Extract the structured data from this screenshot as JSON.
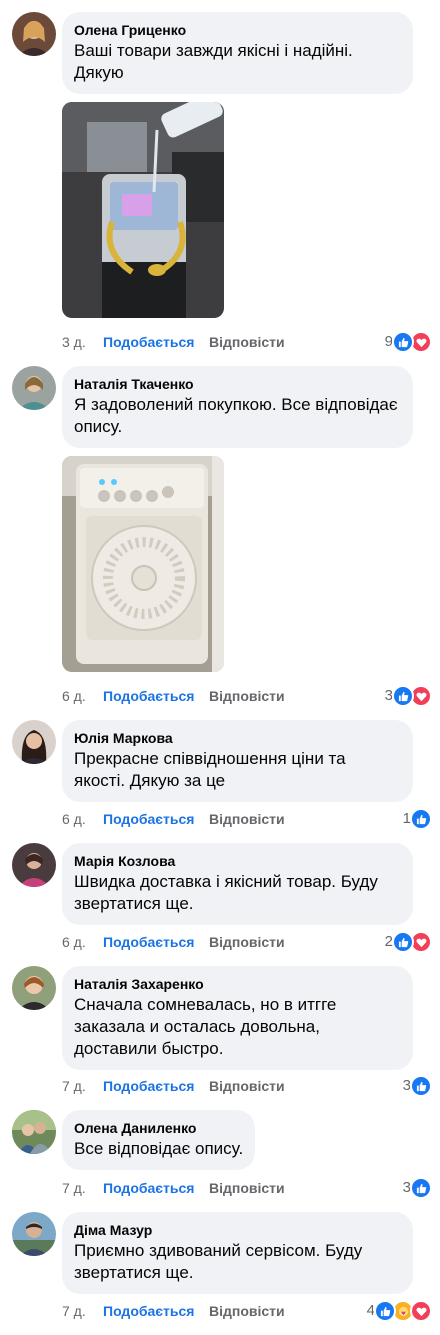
{
  "actions": {
    "like_label": "Подобається",
    "reply_label": "Відповісти"
  },
  "comments": [
    {
      "author": "Олена Гриценко",
      "text": "Ваші товари завжди якісні і надійні. Дякую",
      "time": "3 д.",
      "reactions_count": "9",
      "reaction_types": [
        "like",
        "heart"
      ]
    },
    {
      "author": "Наталія Ткаченко",
      "text": "Я задоволений покупкою. Все відповідає опису.",
      "time": "6 д.",
      "reactions_count": "3",
      "reaction_types": [
        "like",
        "heart"
      ]
    },
    {
      "author": "Юлія Маркова",
      "text": "Прекрасне співвідношення ціни та якості. Дякую за це",
      "time": "6 д.",
      "reactions_count": "1",
      "reaction_types": [
        "like"
      ]
    },
    {
      "author": "Марія Козлова",
      "text": "Швидка доставка і якісний товар. Буду звертатися ще.",
      "time": "6 д.",
      "reactions_count": "2",
      "reaction_types": [
        "like",
        "heart"
      ]
    },
    {
      "author": "Наталія Захаренко",
      "text": "Сначала сомневалась, но в итгге заказала и осталась довольна, доставили быстро.",
      "time": "7 д.",
      "reactions_count": "3",
      "reaction_types": [
        "like"
      ]
    },
    {
      "author": "Олена Даниленко",
      "text": "Все відповідає опису.",
      "time": "7 д.",
      "reactions_count": "3",
      "reaction_types": [
        "like"
      ]
    },
    {
      "author": "Діма Мазур",
      "text": "Приємно здивований сервісом. Буду звертатися ще.",
      "time": "7 д.",
      "reactions_count": "4",
      "reaction_types": [
        "like",
        "care",
        "heart"
      ]
    }
  ],
  "colors": {
    "link": "#1b74e4",
    "bubble": "#f0f2f5",
    "muted": "#65676b",
    "like": "#1877f2",
    "heart": "#f33e58"
  }
}
